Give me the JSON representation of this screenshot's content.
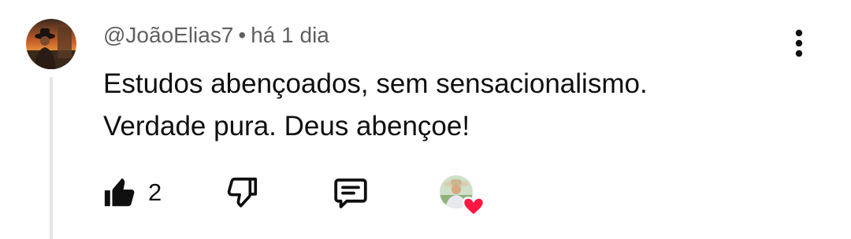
{
  "comment": {
    "author": "@JoãoElias7",
    "separator": "•",
    "time": "há 1 dia",
    "text_lines": [
      "Estudos abençoados, sem sensacionalismo.",
      "Verdade pura. Deus abençoe!"
    ]
  },
  "actions": {
    "like_count": "2"
  },
  "icons": {
    "like": "thumb-up-filled-icon",
    "dislike": "thumb-down-outline-icon",
    "reply": "comment-icon",
    "more": "more-vertical-icon",
    "heart": "heart-icon"
  },
  "colors": {
    "heart": "#ff1744",
    "meta_text": "#606060",
    "thread_line": "#e5e5e5"
  }
}
